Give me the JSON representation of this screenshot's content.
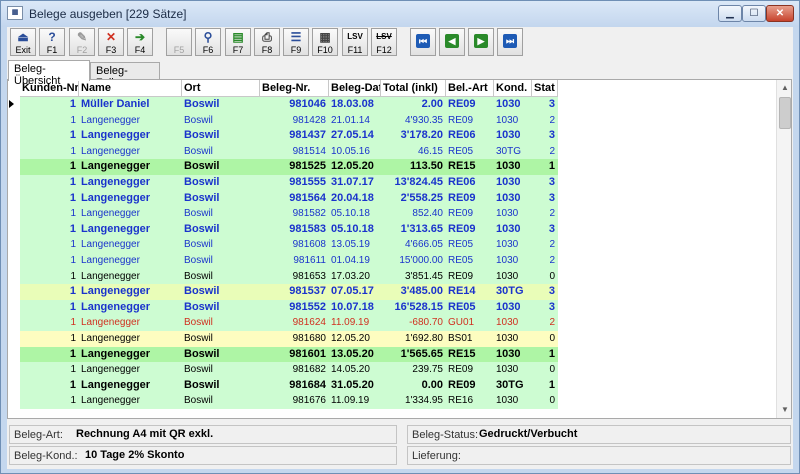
{
  "window": {
    "title": "Belege ausgeben [229 Sätze]",
    "app_icon": "app-icon"
  },
  "toolbar": [
    {
      "label": "Exit",
      "icon": "exit-icon",
      "glyph": "⏏",
      "color": "#2b4e9a"
    },
    {
      "label": "F1",
      "icon": "help-icon",
      "glyph": "?",
      "color": "#2b4e9a"
    },
    {
      "label": "F2",
      "icon": "pencil-icon",
      "glyph": "✎",
      "color": "#999999",
      "disabled": true
    },
    {
      "label": "F3",
      "icon": "delete-x-icon",
      "glyph": "✕",
      "color": "#d03020"
    },
    {
      "label": "F4",
      "icon": "new-arrow-icon",
      "glyph": "➔",
      "color": "#2a8a2a"
    },
    {
      "label": "F5",
      "icon": "blank-icon",
      "glyph": "",
      "color": "#999999",
      "disabled": true
    },
    {
      "label": "F6",
      "icon": "search-icon",
      "glyph": "⚲",
      "color": "#2b4e9a"
    },
    {
      "label": "F7",
      "icon": "document-icon",
      "glyph": "▤",
      "color": "#2a8a2a"
    },
    {
      "label": "F8",
      "icon": "print-icon",
      "glyph": "⎙",
      "color": "#444444"
    },
    {
      "label": "F9",
      "icon": "list-icon",
      "glyph": "☰",
      "color": "#2b4e9a"
    },
    {
      "label": "F10",
      "icon": "print-list-icon",
      "glyph": "▦",
      "color": "#444444"
    },
    {
      "label": "F11",
      "icon": "lsv-icon",
      "glyph": "LSV",
      "color": "#000000"
    },
    {
      "label": "F12",
      "icon": "lsv-strike-icon",
      "glyph": "LSV",
      "color": "#000000"
    }
  ],
  "nav_buttons": [
    {
      "name": "first-record-button",
      "icon": "first-icon",
      "glyph": "⏮",
      "color": "#1e5bb5"
    },
    {
      "name": "previous-record-button",
      "icon": "previous-icon",
      "glyph": "◀",
      "color": "#2a8a2a"
    },
    {
      "name": "next-record-button",
      "icon": "next-icon",
      "glyph": "▶",
      "color": "#2a8a2a"
    },
    {
      "name": "last-record-button",
      "icon": "last-icon",
      "glyph": "⏭",
      "color": "#1e5bb5"
    }
  ],
  "tabs": [
    "Beleg-Übersicht",
    "Beleg-Zeilen"
  ],
  "columns": [
    "Kunden-Nr",
    "Name",
    "Ort",
    "Beleg-Nr.",
    "Beleg-Datum",
    "Total (inkl)",
    "Bel.-Art",
    "Kond.",
    "Stat"
  ],
  "rows": [
    {
      "cells": [
        "1",
        "Müller Daniel",
        "Boswil",
        "981046",
        "18.03.08",
        "2.00",
        "RE09",
        "1030",
        "3"
      ],
      "bg": "#cdfcd2",
      "color": "#1a33cc",
      "bold": true
    },
    {
      "cells": [
        "1",
        "Langenegger",
        "Boswil",
        "981428",
        "21.01.14",
        "4'930.35",
        "RE09",
        "1030",
        "2"
      ],
      "bg": "#cdfcd2",
      "color": "#1a33cc",
      "bold": false
    },
    {
      "cells": [
        "1",
        "Langenegger",
        "Boswil",
        "981437",
        "27.05.14",
        "3'178.20",
        "RE06",
        "1030",
        "3"
      ],
      "bg": "#cdfcd2",
      "color": "#1a33cc",
      "bold": true
    },
    {
      "cells": [
        "1",
        "Langenegger",
        "Boswil",
        "981514",
        "10.05.16",
        "46.15",
        "RE05",
        "30TG",
        "2"
      ],
      "bg": "#cdfcd2",
      "color": "#1a33cc",
      "bold": false
    },
    {
      "cells": [
        "1",
        "Langenegger",
        "Boswil",
        "981525",
        "12.05.20",
        "113.50",
        "RE15",
        "1030",
        "1"
      ],
      "bg": "#aef5a5",
      "color": "#000000",
      "bold": true
    },
    {
      "cells": [
        "1",
        "Langenegger",
        "Boswil",
        "981555",
        "31.07.17",
        "13'824.45",
        "RE06",
        "1030",
        "3"
      ],
      "bg": "#cdfcd2",
      "color": "#1a33cc",
      "bold": true
    },
    {
      "cells": [
        "1",
        "Langenegger",
        "Boswil",
        "981564",
        "20.04.18",
        "2'558.25",
        "RE09",
        "1030",
        "3"
      ],
      "bg": "#cdfcd2",
      "color": "#1a33cc",
      "bold": true
    },
    {
      "cells": [
        "1",
        "Langenegger",
        "Boswil",
        "981582",
        "05.10.18",
        "852.40",
        "RE09",
        "1030",
        "2"
      ],
      "bg": "#cdfcd2",
      "color": "#1a33cc",
      "bold": false
    },
    {
      "cells": [
        "1",
        "Langenegger",
        "Boswil",
        "981583",
        "05.10.18",
        "1'313.65",
        "RE09",
        "1030",
        "3"
      ],
      "bg": "#cdfcd2",
      "color": "#1a33cc",
      "bold": true
    },
    {
      "cells": [
        "1",
        "Langenegger",
        "Boswil",
        "981608",
        "13.05.19",
        "4'666.05",
        "RE05",
        "1030",
        "2"
      ],
      "bg": "#cdfcd2",
      "color": "#1a33cc",
      "bold": false
    },
    {
      "cells": [
        "1",
        "Langenegger",
        "Boswil",
        "981611",
        "01.04.19",
        "15'000.00",
        "RE05",
        "1030",
        "2"
      ],
      "bg": "#cdfcd2",
      "color": "#1a33cc",
      "bold": false
    },
    {
      "cells": [
        "1",
        "Langenegger",
        "Boswil",
        "981653",
        "17.03.20",
        "3'851.45",
        "RE09",
        "1030",
        "0"
      ],
      "bg": "#cdfcd2",
      "color": "#000000",
      "bold": false
    },
    {
      "cells": [
        "1",
        "Langenegger",
        "Boswil",
        "981537",
        "07.05.17",
        "3'485.00",
        "RE14",
        "30TG",
        "3"
      ],
      "bg": "#e9fdb8",
      "color": "#1a33cc",
      "bold": true
    },
    {
      "cells": [
        "1",
        "Langenegger",
        "Boswil",
        "981552",
        "10.07.18",
        "16'528.15",
        "RE05",
        "1030",
        "3"
      ],
      "bg": "#cdfcd2",
      "color": "#1a33cc",
      "bold": true
    },
    {
      "cells": [
        "1",
        "Langenegger",
        "Boswil",
        "981624",
        "11.09.19",
        "-680.70",
        "GU01",
        "1030",
        "2"
      ],
      "bg": "#cdfcd2",
      "color": "#d03020",
      "bold": false
    },
    {
      "cells": [
        "1",
        "Langenegger",
        "Boswil",
        "981680",
        "12.05.20",
        "1'692.80",
        "BS01",
        "1030",
        "0"
      ],
      "bg": "#fdfdc0",
      "color": "#000000",
      "bold": false
    },
    {
      "cells": [
        "1",
        "Langenegger",
        "Boswil",
        "981601",
        "13.05.20",
        "1'565.65",
        "RE15",
        "1030",
        "1"
      ],
      "bg": "#aef5a5",
      "color": "#000000",
      "bold": true
    },
    {
      "cells": [
        "1",
        "Langenegger",
        "Boswil",
        "981682",
        "14.05.20",
        "239.75",
        "RE09",
        "1030",
        "0"
      ],
      "bg": "#cdfcd2",
      "color": "#000000",
      "bold": false
    },
    {
      "cells": [
        "1",
        "Langenegger",
        "Boswil",
        "981684",
        "31.05.20",
        "0.00",
        "RE09",
        "30TG",
        "1"
      ],
      "bg": "#cdfcd2",
      "color": "#000000",
      "bold": true
    },
    {
      "cells": [
        "1",
        "Langenegger",
        "Boswil",
        "981676",
        "11.09.19",
        "1'334.95",
        "RE16",
        "1030",
        "0"
      ],
      "bg": "#cdfcd2",
      "color": "#000000",
      "bold": false
    }
  ],
  "status": {
    "beleg_art_label": "Beleg-Art:",
    "beleg_art_value": "Rechnung A4 mit QR exkl.",
    "beleg_kond_label": "Beleg-Kond.:",
    "beleg_kond_value": "10 Tage 2% Skonto",
    "beleg_status_label": "Beleg-Status:",
    "beleg_status_value": "Gedruckt/Verbucht",
    "lieferung_label": "Lieferung:",
    "lieferung_value": ""
  }
}
